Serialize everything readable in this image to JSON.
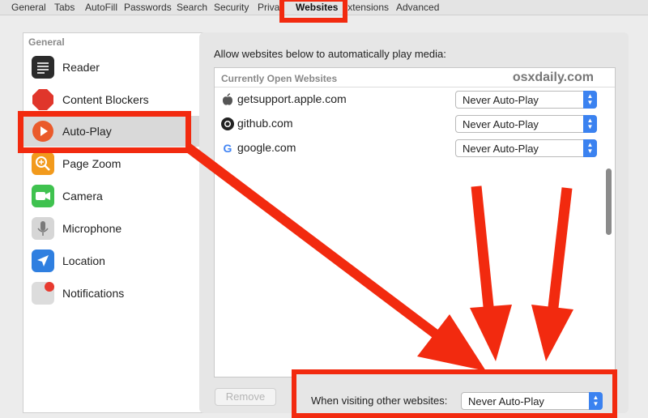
{
  "tabs": [
    {
      "label": "General"
    },
    {
      "label": "Tabs"
    },
    {
      "label": "AutoFill"
    },
    {
      "label": "Passwords"
    },
    {
      "label": "Search"
    },
    {
      "label": "Security"
    },
    {
      "label": "Privacy"
    },
    {
      "label": "Websites"
    },
    {
      "label": "Extensions"
    },
    {
      "label": "Advanced"
    }
  ],
  "selected_tab": "Websites",
  "sidebar": {
    "header": "General",
    "items": [
      {
        "label": "Reader",
        "icon": "reader-icon"
      },
      {
        "label": "Content Blockers",
        "icon": "content-blockers-icon"
      },
      {
        "label": "Auto-Play",
        "icon": "auto-play-icon",
        "selected": true
      },
      {
        "label": "Page Zoom",
        "icon": "page-zoom-icon"
      },
      {
        "label": "Camera",
        "icon": "camera-icon"
      },
      {
        "label": "Microphone",
        "icon": "microphone-icon"
      },
      {
        "label": "Location",
        "icon": "location-icon"
      },
      {
        "label": "Notifications",
        "icon": "notifications-icon"
      }
    ]
  },
  "main": {
    "prompt": "Allow websites below to automatically play media:",
    "list_header": "Currently Open Websites",
    "watermark": "osxdaily.com",
    "sites": [
      {
        "name": "getsupport.apple.com",
        "icon": "apple-icon",
        "setting": "Never Auto-Play"
      },
      {
        "name": "github.com",
        "icon": "github-icon",
        "setting": "Never Auto-Play"
      },
      {
        "name": "google.com",
        "icon": "google-icon",
        "setting": "Never Auto-Play"
      }
    ],
    "remove_label": "Remove",
    "other_label": "When visiting other websites:",
    "other_setting": "Never Auto-Play"
  },
  "colors": {
    "highlight": "#f22a0f",
    "select_accent": "#3b82f0"
  }
}
